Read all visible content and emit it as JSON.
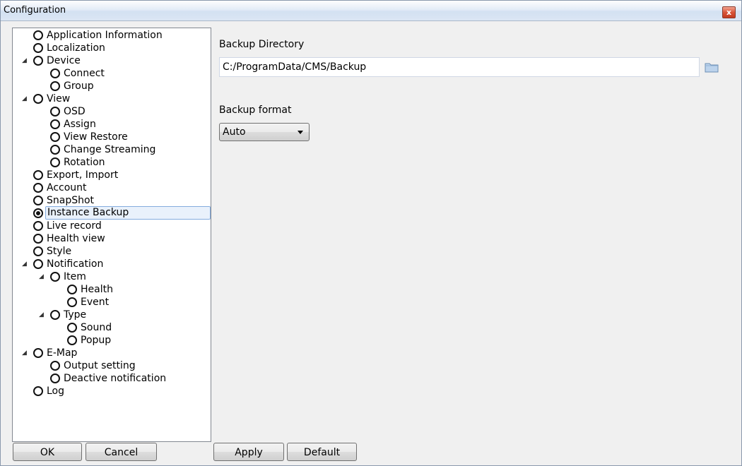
{
  "window": {
    "title": "Configuration",
    "close_label": "x"
  },
  "tree": [
    {
      "label": "Application Information",
      "level": 1,
      "expander": "",
      "selected": false
    },
    {
      "label": "Localization",
      "level": 1,
      "expander": "",
      "selected": false
    },
    {
      "label": "Device",
      "level": 1,
      "expander": "◢",
      "selected": false
    },
    {
      "label": "Connect",
      "level": 2,
      "expander": "",
      "selected": false
    },
    {
      "label": "Group",
      "level": 2,
      "expander": "",
      "selected": false
    },
    {
      "label": "View",
      "level": 1,
      "expander": "◢",
      "selected": false
    },
    {
      "label": "OSD",
      "level": 2,
      "expander": "",
      "selected": false
    },
    {
      "label": "Assign",
      "level": 2,
      "expander": "",
      "selected": false
    },
    {
      "label": "View Restore",
      "level": 2,
      "expander": "",
      "selected": false
    },
    {
      "label": "Change Streaming",
      "level": 2,
      "expander": "",
      "selected": false
    },
    {
      "label": "Rotation",
      "level": 2,
      "expander": "",
      "selected": false
    },
    {
      "label": "Export, Import",
      "level": 1,
      "expander": "",
      "selected": false
    },
    {
      "label": "Account",
      "level": 1,
      "expander": "",
      "selected": false
    },
    {
      "label": "SnapShot",
      "level": 1,
      "expander": "",
      "selected": false
    },
    {
      "label": "Instance Backup",
      "level": 1,
      "expander": "",
      "selected": true
    },
    {
      "label": "Live record",
      "level": 1,
      "expander": "",
      "selected": false
    },
    {
      "label": "Health view",
      "level": 1,
      "expander": "",
      "selected": false
    },
    {
      "label": "Style",
      "level": 1,
      "expander": "",
      "selected": false
    },
    {
      "label": "Notification",
      "level": 1,
      "expander": "◢",
      "selected": false
    },
    {
      "label": "Item",
      "level": 2,
      "expander": "◢",
      "selected": false
    },
    {
      "label": "Health",
      "level": 3,
      "expander": "",
      "selected": false
    },
    {
      "label": "Event",
      "level": 3,
      "expander": "",
      "selected": false
    },
    {
      "label": "Type",
      "level": 2,
      "expander": "◢",
      "selected": false
    },
    {
      "label": "Sound",
      "level": 3,
      "expander": "",
      "selected": false
    },
    {
      "label": "Popup",
      "level": 3,
      "expander": "",
      "selected": false
    },
    {
      "label": "E-Map",
      "level": 1,
      "expander": "◢",
      "selected": false
    },
    {
      "label": "Output setting",
      "level": 2,
      "expander": "",
      "selected": false
    },
    {
      "label": "Deactive notification",
      "level": 2,
      "expander": "",
      "selected": false
    },
    {
      "label": "Log",
      "level": 1,
      "expander": "",
      "selected": false
    }
  ],
  "panel": {
    "backup_directory_label": "Backup Directory",
    "backup_directory_value": "C:/ProgramData/CMS/Backup",
    "backup_format_label": "Backup format",
    "backup_format_value": "Auto"
  },
  "buttons": {
    "ok": "OK",
    "cancel": "Cancel",
    "apply": "Apply",
    "default": "Default"
  }
}
